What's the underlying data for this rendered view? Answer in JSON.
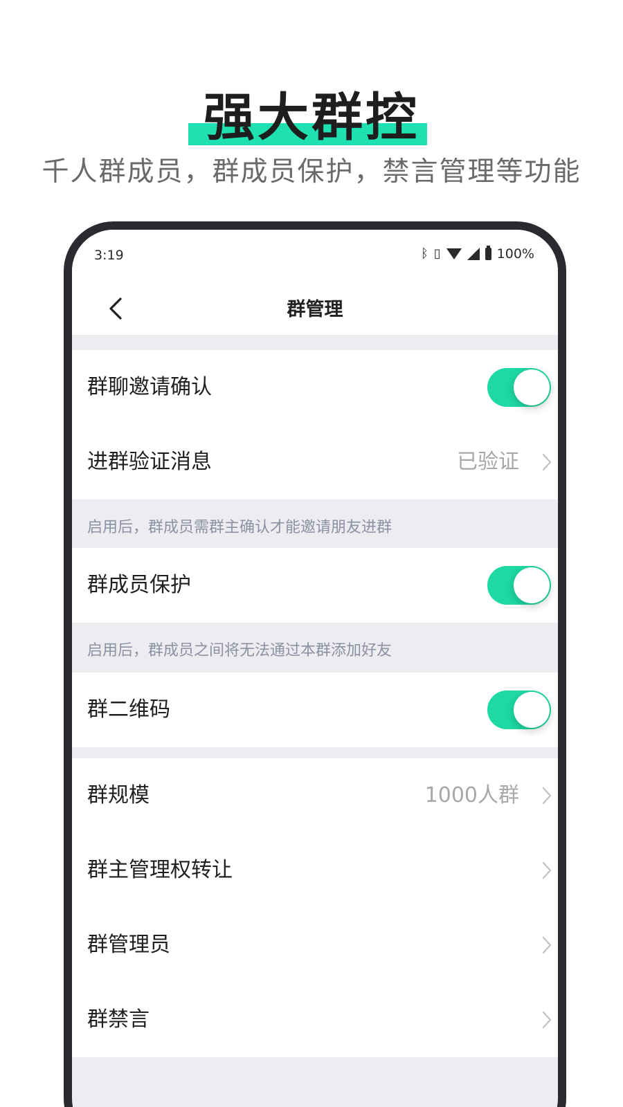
{
  "promo": {
    "headline": "强大群控",
    "subtitle": "千人群成员，群成员保护，禁言管理等功能",
    "highlight_color": "#1fe0b0"
  },
  "statusbar": {
    "time": "3:19",
    "battery": "100%",
    "icons": [
      "bluetooth-icon",
      "vibrate-icon",
      "wifi-icon",
      "signal-icon",
      "battery-icon"
    ]
  },
  "navbar": {
    "back_icon": "chevron-left-icon",
    "title": "群管理"
  },
  "settings": {
    "invite_confirm": {
      "label": "群聊邀请确认",
      "enabled": true
    },
    "verify_message": {
      "label": "进群验证消息",
      "value": "已验证"
    },
    "hint_invite": "启用后，群成员需群主确认才能邀请朋友进群",
    "member_protect": {
      "label": "群成员保护",
      "enabled": true
    },
    "hint_protect": "启用后，群成员之间将无法通过本群添加好友",
    "qr_code": {
      "label": "群二维码",
      "enabled": true
    },
    "group_size": {
      "label": "群规模",
      "value": "1000人群"
    },
    "transfer_owner": {
      "label": "群主管理权转让"
    },
    "admins": {
      "label": "群管理员"
    },
    "mute": {
      "label": "群禁言"
    }
  },
  "colors": {
    "accent": "#1ed9a4",
    "frame": "#2a2b30",
    "background": "#ededf1",
    "hint_text": "#8c90a3"
  }
}
